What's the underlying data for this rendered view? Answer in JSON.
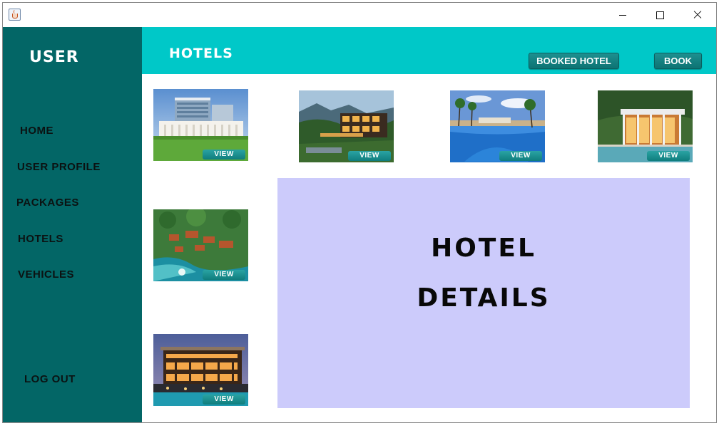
{
  "window": {
    "controls": [
      "minimize",
      "maximize",
      "close"
    ]
  },
  "sidebar": {
    "title": "USER",
    "items": [
      {
        "label": "HOME"
      },
      {
        "label": "USER PROFILE"
      },
      {
        "label": "PACKAGES"
      },
      {
        "label": "HOTELS"
      },
      {
        "label": "VEHICLES"
      }
    ],
    "logout_label": "LOG OUT"
  },
  "header": {
    "title": "HOTELS",
    "booked_hotel_label": "BOOKED HOTEL",
    "book_label": "BOOK"
  },
  "hotels": [
    {
      "image": "hotel-photo-1",
      "view_label": "VIEW"
    },
    {
      "image": "hotel-photo-2",
      "view_label": "VIEW"
    },
    {
      "image": "hotel-photo-3",
      "view_label": "VIEW"
    },
    {
      "image": "hotel-photo-4",
      "view_label": "VIEW"
    },
    {
      "image": "hotel-photo-5",
      "view_label": "VIEW"
    },
    {
      "image": "hotel-photo-6",
      "view_label": "VIEW"
    }
  ],
  "details_panel": {
    "line1": "HOTEL",
    "line2": "DETAILS"
  },
  "colors": {
    "sidebar": "#036666",
    "header": "#00c8c8",
    "button": "#0d7373",
    "details_panel": "#cccbfb"
  }
}
